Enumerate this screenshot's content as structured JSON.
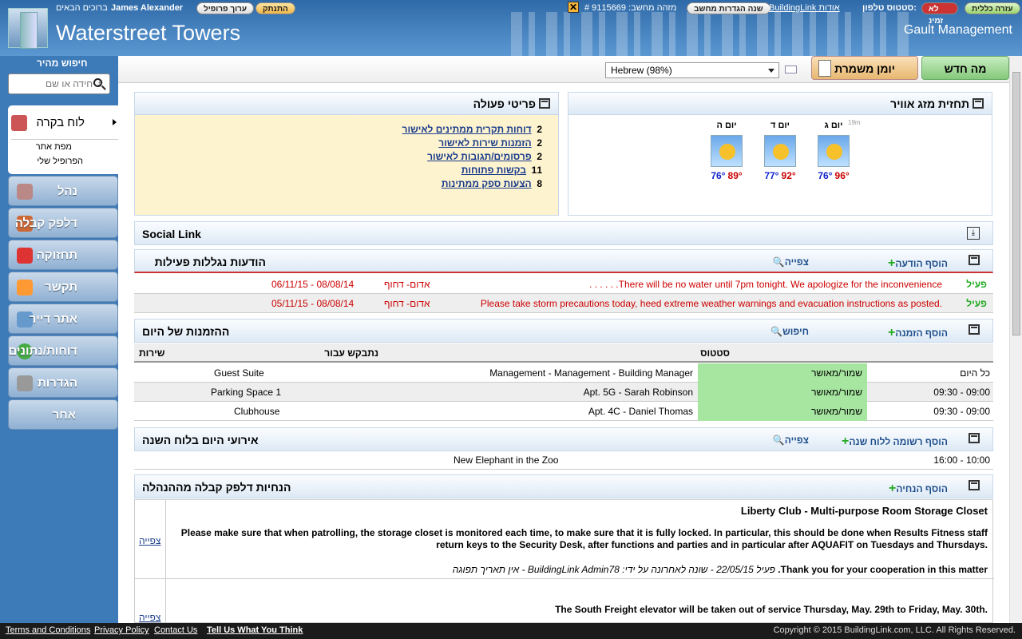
{
  "header": {
    "title": "Waterstreet Towers",
    "company": "Gault Management",
    "welcome": "ברוכים הבאים",
    "user": "James Alexander",
    "edit_profile": "ערוך פרופיל",
    "logout": "התנתק",
    "computer_id": "# 9115669  :מזהה מחשב",
    "change_settings": "שנה הגדרות מחשב",
    "about": "BuildingLink אודות",
    "phone_status": "סטטוס טלפון:",
    "phone_state": "לא זמינ",
    "general_help": "עזרה כללית"
  },
  "sidebar": {
    "quick_search": "חיפוש מהיר",
    "search_placeholder": "יחידה או שם #",
    "open_item": "לוח בקרה",
    "sub_items": [
      "מפת אתר",
      "הפרופיל שלי"
    ],
    "items": [
      "נהל",
      "דלפק קבלה",
      "תחזוקה",
      "תקשר",
      "אתר דייר",
      "דוחות/נתונים",
      "הגדרות",
      "אחר"
    ]
  },
  "toolbar": {
    "new_button": "מה חדש",
    "log_button": "יומן משמרת",
    "language": "Hebrew (98%)"
  },
  "action_items": {
    "title": "פריטי פעולה",
    "items": [
      {
        "count": "2",
        "label": "דוחות תקרית ממתינים לאישור"
      },
      {
        "count": "2",
        "label": "הזמנות שירות לאישור"
      },
      {
        "count": "2",
        "label": "פרסומים/תגובות לאישור"
      },
      {
        "count": "11",
        "label": "בקשות פתוחות"
      },
      {
        "count": "8",
        "label": "הצעות ספק ממתינות"
      }
    ]
  },
  "weather": {
    "title": "תחזית מזג אוויר",
    "age": "19m",
    "days": [
      {
        "day": "יום ג",
        "hi": "96°",
        "lo": "76°"
      },
      {
        "day": "יום ד",
        "hi": "92°",
        "lo": "77°"
      },
      {
        "day": "יום ה",
        "hi": "89°",
        "lo": "76°"
      }
    ]
  },
  "social": {
    "title": "Social Link"
  },
  "announcements": {
    "title": "הודעות נגללות פעילות",
    "add": "הוסף הודעה",
    "view": "צפייה",
    "rows": [
      {
        "status": "פעיל",
        "text": ". . . . . .There will be no water until 7pm tonight. We apologize for the inconvenience",
        "color": "אדום- דחוף",
        "dates": "06/11/15 - 08/08/14"
      },
      {
        "status": "פעיל",
        "text": "Please take storm precautions today, heed extreme weather warnings and evacuation instructions as posted.",
        "color": "אדום- דחוף",
        "dates": "05/11/15 - 08/08/14"
      }
    ]
  },
  "reservations": {
    "title": "ההזמנות של היום",
    "add": "הוסף הזמנה",
    "search": "חיפוש",
    "headers": [
      "",
      "סטטוס",
      "נתבקש עבור",
      "שירות"
    ],
    "rows": [
      {
        "time": "כל היום",
        "status": "שמור/מאושר",
        "for": "Management - Management - Building Manager",
        "service": "Guest Suite"
      },
      {
        "time": "09:30 - 09:00",
        "status": "שמור/מאושר",
        "for": "Apt. 5G - Sarah Robinson",
        "service": "Parking Space 1"
      },
      {
        "time": "09:30 - 09:00",
        "status": "שמור/מאושר",
        "for": "Apt. 4C - Daniel Thomas",
        "service": "Clubhouse"
      }
    ]
  },
  "calendar": {
    "title": "אירועי היום בלוח השנה",
    "add": "הוסף רשומה ללוח שנה",
    "view": "צפייה",
    "rows": [
      {
        "time": "16:00 - 10:00",
        "event": "New Elephant in the Zoo"
      }
    ]
  },
  "instructions": {
    "title": "הנחיות דלפק קבלה מההנהלה",
    "add": "הוסף הנחיה",
    "view": "צפייה",
    "items": [
      {
        "heading": "Liberty Club - Multi-purpose Room Storage Closet",
        "body": "Please make sure that when patrolling, the storage closet is monitored each time, to make sure that it is fully locked. In particular, this should be done when Results Fitness staff return keys to the Security Desk, after functions and parties and in particular after AQUAFIT on Tuesdays and Thursdays.",
        "thanks": "Thank you for your cooperation in this matter.",
        "meta": "פעיל 22/05/15 - שונה לאחרונה על ידי: BuildingLink Admin78 - אין תאריך תפוגה"
      },
      {
        "heading": "The South Freight elevator will be taken out of service Thursday, May. 29th to Friday, May. 30th."
      }
    ]
  },
  "footer": {
    "terms": "Terms and Conditions",
    "privacy": "Privacy Policy",
    "contact": "Contact Us",
    "tell": "Tell Us What You Think",
    "copyright": "Copyright © 2015 BuildingLink.com, LLC.  All Rights Reserved."
  }
}
